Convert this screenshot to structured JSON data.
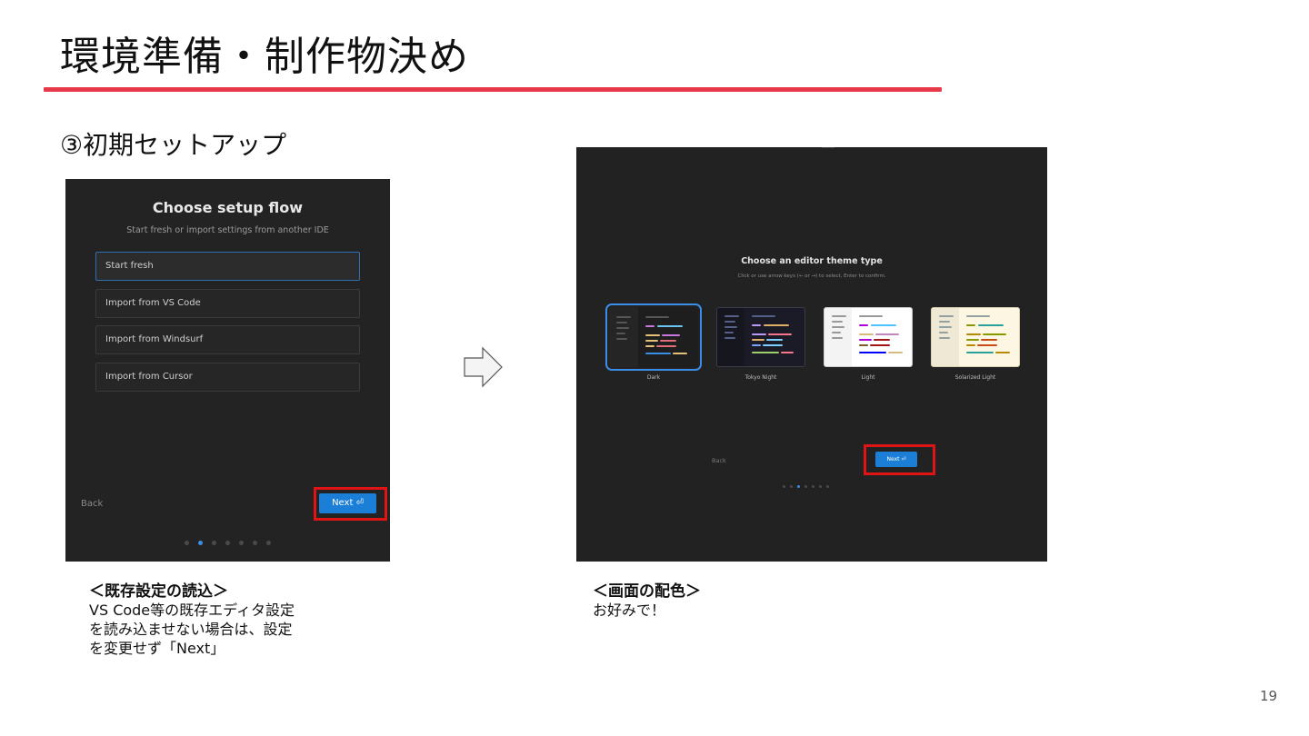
{
  "slide": {
    "title": "環境準備・制作物決め",
    "subtitle": "③初期セットアップ",
    "page_number": "19",
    "accent_color": "#e8394a"
  },
  "setup_flow": {
    "heading": "Choose setup flow",
    "description": "Start fresh or import settings from another IDE",
    "options": [
      "Start fresh",
      "Import from VS Code",
      "Import from Windsurf",
      "Import from Cursor"
    ],
    "selected_option": "Start fresh",
    "back_label": "Back",
    "next_label": "Next ⏎",
    "progress": {
      "total_steps": 7,
      "current_step": 2
    }
  },
  "arrow_icon": "right-arrow-icon",
  "theme_picker": {
    "heading": "Choose an editor theme type",
    "description": "Click or use arrow keys (← or →) to select, Enter to confirm.",
    "themes": [
      "Dark",
      "Tokyo Night",
      "Light",
      "Solarized Light"
    ],
    "selected_theme": "Dark",
    "back_label": "Back",
    "next_label": "Next ⏎",
    "progress": {
      "total_steps": 7,
      "current_step": 3
    }
  },
  "captions": {
    "left": {
      "heading": "＜既存設定の読込＞",
      "lines": [
        "VS Code等の既存エディタ設定",
        "を読み込ませない場合は、設定",
        "を変更せず「Next」"
      ]
    },
    "right": {
      "heading": "＜画面の配色＞",
      "lines": [
        "お好みで！"
      ]
    }
  },
  "highlight_color": "#e01414",
  "button_color": "#1b7fd8"
}
